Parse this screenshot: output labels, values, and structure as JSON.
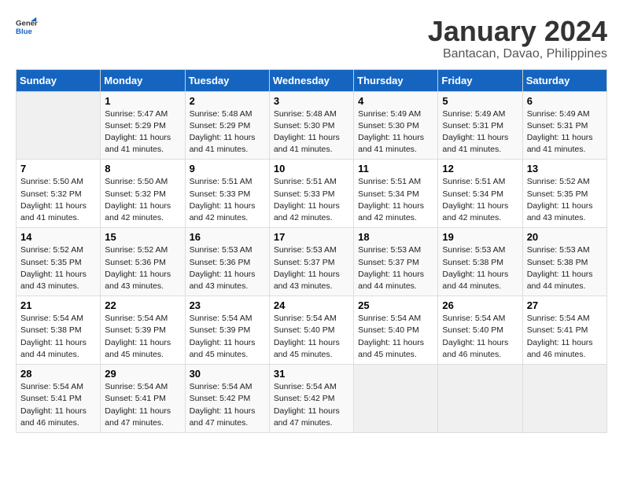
{
  "header": {
    "logo_general": "General",
    "logo_blue": "Blue",
    "month_title": "January 2024",
    "location": "Bantacan, Davao, Philippines"
  },
  "calendar": {
    "days_of_week": [
      "Sunday",
      "Monday",
      "Tuesday",
      "Wednesday",
      "Thursday",
      "Friday",
      "Saturday"
    ],
    "weeks": [
      [
        {
          "day": "",
          "info": ""
        },
        {
          "day": "1",
          "info": "Sunrise: 5:47 AM\nSunset: 5:29 PM\nDaylight: 11 hours\nand 41 minutes."
        },
        {
          "day": "2",
          "info": "Sunrise: 5:48 AM\nSunset: 5:29 PM\nDaylight: 11 hours\nand 41 minutes."
        },
        {
          "day": "3",
          "info": "Sunrise: 5:48 AM\nSunset: 5:30 PM\nDaylight: 11 hours\nand 41 minutes."
        },
        {
          "day": "4",
          "info": "Sunrise: 5:49 AM\nSunset: 5:30 PM\nDaylight: 11 hours\nand 41 minutes."
        },
        {
          "day": "5",
          "info": "Sunrise: 5:49 AM\nSunset: 5:31 PM\nDaylight: 11 hours\nand 41 minutes."
        },
        {
          "day": "6",
          "info": "Sunrise: 5:49 AM\nSunset: 5:31 PM\nDaylight: 11 hours\nand 41 minutes."
        }
      ],
      [
        {
          "day": "7",
          "info": "Sunrise: 5:50 AM\nSunset: 5:32 PM\nDaylight: 11 hours\nand 41 minutes."
        },
        {
          "day": "8",
          "info": "Sunrise: 5:50 AM\nSunset: 5:32 PM\nDaylight: 11 hours\nand 42 minutes."
        },
        {
          "day": "9",
          "info": "Sunrise: 5:51 AM\nSunset: 5:33 PM\nDaylight: 11 hours\nand 42 minutes."
        },
        {
          "day": "10",
          "info": "Sunrise: 5:51 AM\nSunset: 5:33 PM\nDaylight: 11 hours\nand 42 minutes."
        },
        {
          "day": "11",
          "info": "Sunrise: 5:51 AM\nSunset: 5:34 PM\nDaylight: 11 hours\nand 42 minutes."
        },
        {
          "day": "12",
          "info": "Sunrise: 5:51 AM\nSunset: 5:34 PM\nDaylight: 11 hours\nand 42 minutes."
        },
        {
          "day": "13",
          "info": "Sunrise: 5:52 AM\nSunset: 5:35 PM\nDaylight: 11 hours\nand 43 minutes."
        }
      ],
      [
        {
          "day": "14",
          "info": "Sunrise: 5:52 AM\nSunset: 5:35 PM\nDaylight: 11 hours\nand 43 minutes."
        },
        {
          "day": "15",
          "info": "Sunrise: 5:52 AM\nSunset: 5:36 PM\nDaylight: 11 hours\nand 43 minutes."
        },
        {
          "day": "16",
          "info": "Sunrise: 5:53 AM\nSunset: 5:36 PM\nDaylight: 11 hours\nand 43 minutes."
        },
        {
          "day": "17",
          "info": "Sunrise: 5:53 AM\nSunset: 5:37 PM\nDaylight: 11 hours\nand 43 minutes."
        },
        {
          "day": "18",
          "info": "Sunrise: 5:53 AM\nSunset: 5:37 PM\nDaylight: 11 hours\nand 44 minutes."
        },
        {
          "day": "19",
          "info": "Sunrise: 5:53 AM\nSunset: 5:38 PM\nDaylight: 11 hours\nand 44 minutes."
        },
        {
          "day": "20",
          "info": "Sunrise: 5:53 AM\nSunset: 5:38 PM\nDaylight: 11 hours\nand 44 minutes."
        }
      ],
      [
        {
          "day": "21",
          "info": "Sunrise: 5:54 AM\nSunset: 5:38 PM\nDaylight: 11 hours\nand 44 minutes."
        },
        {
          "day": "22",
          "info": "Sunrise: 5:54 AM\nSunset: 5:39 PM\nDaylight: 11 hours\nand 45 minutes."
        },
        {
          "day": "23",
          "info": "Sunrise: 5:54 AM\nSunset: 5:39 PM\nDaylight: 11 hours\nand 45 minutes."
        },
        {
          "day": "24",
          "info": "Sunrise: 5:54 AM\nSunset: 5:40 PM\nDaylight: 11 hours\nand 45 minutes."
        },
        {
          "day": "25",
          "info": "Sunrise: 5:54 AM\nSunset: 5:40 PM\nDaylight: 11 hours\nand 45 minutes."
        },
        {
          "day": "26",
          "info": "Sunrise: 5:54 AM\nSunset: 5:40 PM\nDaylight: 11 hours\nand 46 minutes."
        },
        {
          "day": "27",
          "info": "Sunrise: 5:54 AM\nSunset: 5:41 PM\nDaylight: 11 hours\nand 46 minutes."
        }
      ],
      [
        {
          "day": "28",
          "info": "Sunrise: 5:54 AM\nSunset: 5:41 PM\nDaylight: 11 hours\nand 46 minutes."
        },
        {
          "day": "29",
          "info": "Sunrise: 5:54 AM\nSunset: 5:41 PM\nDaylight: 11 hours\nand 47 minutes."
        },
        {
          "day": "30",
          "info": "Sunrise: 5:54 AM\nSunset: 5:42 PM\nDaylight: 11 hours\nand 47 minutes."
        },
        {
          "day": "31",
          "info": "Sunrise: 5:54 AM\nSunset: 5:42 PM\nDaylight: 11 hours\nand 47 minutes."
        },
        {
          "day": "",
          "info": ""
        },
        {
          "day": "",
          "info": ""
        },
        {
          "day": "",
          "info": ""
        }
      ]
    ]
  }
}
